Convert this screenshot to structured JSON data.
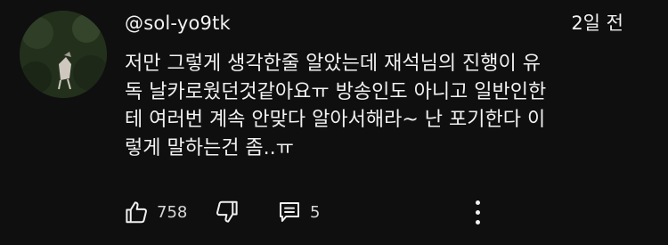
{
  "comment": {
    "author": "@sol-yo9tk",
    "time": "2일 전",
    "text_lines": [
      "저만 그렇게 생각한줄 알았는데 재석님의 진행이 유",
      "독 날카로웠던것같아요ㅠ 방송인도 아니고 일반인한",
      "테 여러번 계속 안맞다 알아서해라~ 난 포기한다 이",
      "렇게 말하는건 좀..ㅠ"
    ],
    "likes": "758",
    "replies": "5"
  },
  "icons": {
    "like": "thumbs-up-icon",
    "dislike": "thumbs-down-icon",
    "reply": "comment-icon",
    "more": "more-vertical-icon"
  }
}
